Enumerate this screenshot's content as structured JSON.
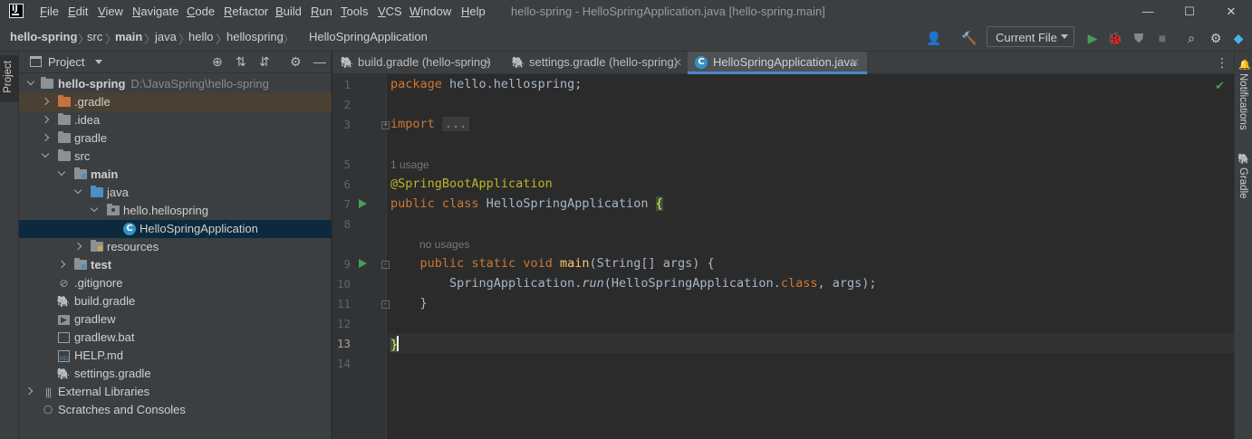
{
  "menu": {
    "items": [
      "File",
      "Edit",
      "View",
      "Navigate",
      "Code",
      "Refactor",
      "Build",
      "Run",
      "Tools",
      "VCS",
      "Window",
      "Help"
    ],
    "logo_text": "IJ"
  },
  "window": {
    "title": "hello-spring - HelloSpringApplication.java [hello-spring.main]",
    "minimize": "—",
    "maximize": "☐",
    "close": "✕"
  },
  "breadcrumb": [
    "hello-spring",
    "src",
    "main",
    "java",
    "hello",
    "hellospring",
    "HelloSpringApplication"
  ],
  "toolbar": {
    "run_config": "Current File"
  },
  "left_stripe": {
    "project_label": "Project"
  },
  "right_stripe": {
    "notifications_label": "Notifications",
    "gradle_label": "Gradle"
  },
  "project_panel": {
    "title": "Project",
    "tree": [
      {
        "label": "hello-spring",
        "path": "D:\\JavaSpring\\hello-spring",
        "bold": true
      },
      {
        "label": ".gradle"
      },
      {
        "label": ".idea"
      },
      {
        "label": "gradle"
      },
      {
        "label": "src"
      },
      {
        "label": "main",
        "bold": true
      },
      {
        "label": "java"
      },
      {
        "label": "hello.hellospring"
      },
      {
        "label": "HelloSpringApplication"
      },
      {
        "label": "resources"
      },
      {
        "label": "test",
        "bold": true
      },
      {
        "label": ".gitignore"
      },
      {
        "label": "build.gradle"
      },
      {
        "label": "gradlew"
      },
      {
        "label": "gradlew.bat"
      },
      {
        "label": "HELP.md"
      },
      {
        "label": "settings.gradle"
      },
      {
        "label": "External Libraries"
      },
      {
        "label": "Scratches and Consoles"
      }
    ]
  },
  "tabs": [
    {
      "label": "build.gradle (hello-spring)",
      "active": false
    },
    {
      "label": "settings.gradle (hello-spring)",
      "active": false
    },
    {
      "label": "HelloSpringApplication.java",
      "active": true
    }
  ],
  "editor": {
    "line_numbers": [
      "1",
      "2",
      "3",
      "5",
      "6",
      "7",
      "8",
      "9",
      "10",
      "11",
      "12",
      "13",
      "14"
    ],
    "current_line": "13",
    "hints": {
      "usage_1": "1 usage",
      "usage_2": "no usages"
    },
    "tokens": {
      "package_kw": "package",
      "package_name": " hello.hellospring;",
      "import_kw": "import",
      "import_fold": "...",
      "annotation": "@SpringBootApplication",
      "public1": "public",
      "class_kw": " class",
      "class_name": " HelloSpringApplication ",
      "open_brace": "{",
      "public2": "public",
      "static_kw": " static",
      "void_kw": " void",
      "main_fn": " main",
      "main_args": "(String[] args) {",
      "app_ref": "SpringApplication.",
      "run_call": "run",
      "run_arg1": "(HelloSpringApplication.",
      "class_lit": "class",
      "run_rest": ", args);",
      "close_inner": "}",
      "close_outer": "}"
    }
  },
  "colors": {
    "background": "#2b2b2b",
    "panel": "#3c3f41",
    "selection": "#0d293e",
    "accent": "#4a88c7",
    "run_green": "#499c54",
    "keyword": "#cc7832",
    "annotation": "#bbb529",
    "function": "#ffc66d"
  }
}
